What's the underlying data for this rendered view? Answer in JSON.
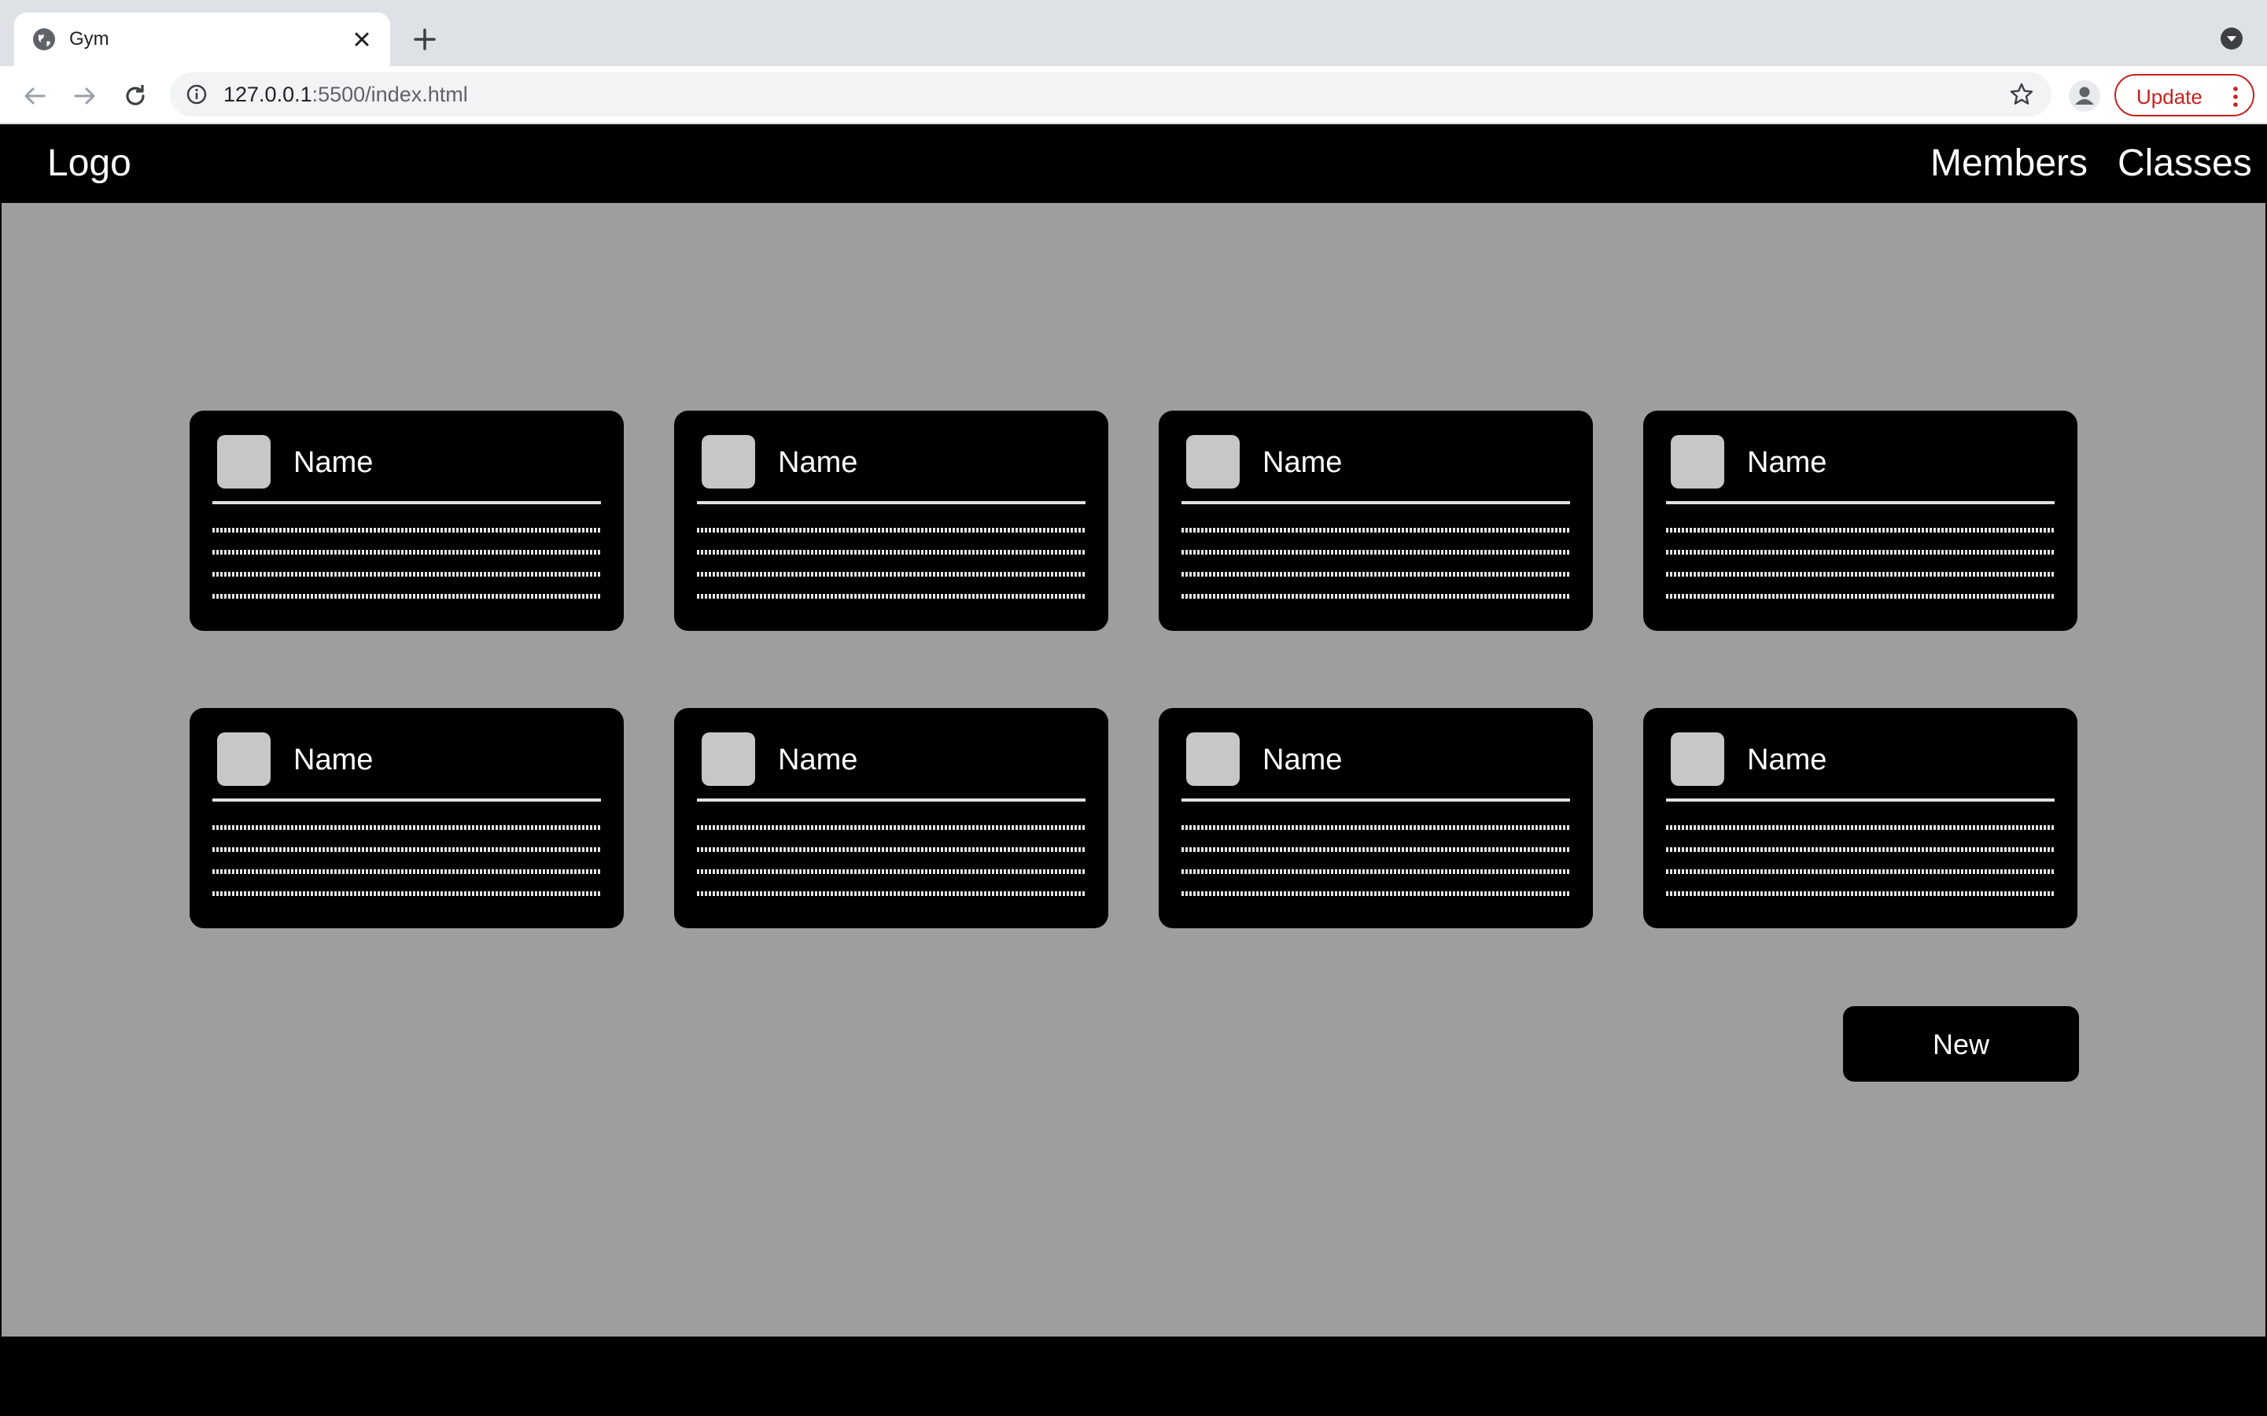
{
  "browser": {
    "tab_title": "Gym",
    "url_host": "127.0.0.1",
    "url_rest": ":5500/index.html",
    "update_label": "Update"
  },
  "header": {
    "logo": "Logo",
    "nav": [
      "Members",
      "Classes"
    ]
  },
  "members": [
    {
      "name": "Name"
    },
    {
      "name": "Name"
    },
    {
      "name": "Name"
    },
    {
      "name": "Name"
    },
    {
      "name": "Name"
    },
    {
      "name": "Name"
    },
    {
      "name": "Name"
    },
    {
      "name": "Name"
    }
  ],
  "actions": {
    "new_label": "New"
  },
  "colors": {
    "page_background": "#9e9e9e",
    "header_background": "#000000",
    "card_background": "#000000",
    "avatar_placeholder": "#c7c7c7",
    "update_accent": "#c5221f"
  }
}
